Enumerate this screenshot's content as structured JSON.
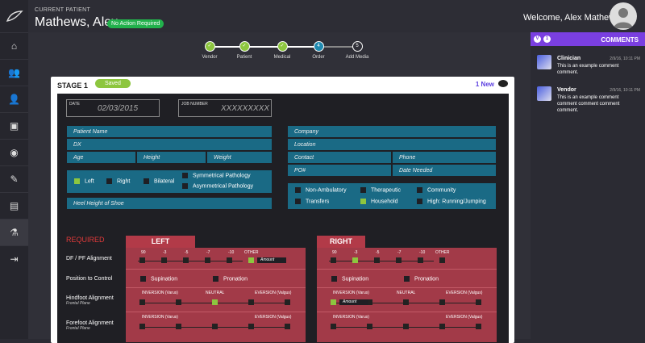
{
  "header": {
    "current_patient_label": "CURRENT PATIENT",
    "patient_name": "Mathews, Alex",
    "status_badge": "No Action Required",
    "welcome": "Welcome, Alex Mathews"
  },
  "stepper": [
    {
      "label": "Vendor",
      "state": "done",
      "num": "✓"
    },
    {
      "label": "Patient",
      "state": "done",
      "num": "✓"
    },
    {
      "label": "Medical",
      "state": "done",
      "num": "✓"
    },
    {
      "label": "Order",
      "state": "current",
      "num": "4"
    },
    {
      "label": "Add Media",
      "state": "todo",
      "num": "5"
    }
  ],
  "stage": {
    "title": "STAGE 1",
    "saved": "Saved",
    "new_comments": "1 New"
  },
  "form": {
    "date_label": "DATE",
    "date_value": "02/03/2015",
    "job_label": "JOB NUMBER",
    "job_value": "XXXXXXXXX",
    "patient_name": "Patient Name",
    "dx": "DX",
    "age": "Age",
    "height": "Height",
    "weight": "Weight",
    "company": "Company",
    "location": "Location",
    "contact": "Contact",
    "phone": "Phone",
    "po": "PO#",
    "date_needed": "Date Needed",
    "left": "Left",
    "right": "Right",
    "bilateral": "Bilateral",
    "sym": "Symmetrical Pathology",
    "asym": "Asymmetrical Pathology",
    "heel": "Heel Height of Shoe",
    "non_amb": "Non-Ambulatory",
    "therapeutic": "Therapeutic",
    "community": "Community",
    "transfers": "Transfers",
    "household": "Household",
    "high": "High: Running/Jumping",
    "required": "REQUIRED",
    "left_hd": "LEFT",
    "right_hd": "RIGHT",
    "dfpf": "DF / PF Alignment",
    "pos_control": "Position to Control",
    "hindfoot": "Hindfoot Alignment",
    "forefoot": "Forefoot Alignment",
    "frontal": "Frontal Plane",
    "supination": "Supination",
    "pronation": "Pronation",
    "inversion": "INVERSION (Varus)",
    "neutral": "NEUTRAL",
    "eversion": "EVERSION (Valgus)",
    "amount": "Amount",
    "other": "OTHER",
    "t90": "90",
    "tm3": "-3",
    "tm5": "-5",
    "tm7": "-7",
    "tm10": "-10"
  },
  "comments": {
    "title": "COMMENTS",
    "badge_v": "V",
    "badge_1": "1",
    "items": [
      {
        "who": "Clinician",
        "time": "2/9/16, 10:11 PM",
        "text": "This is an example comment comment."
      },
      {
        "who": "Vendor",
        "time": "2/9/16, 10:11 PM",
        "text": "This is an example comment comment comment comment comment."
      }
    ]
  }
}
